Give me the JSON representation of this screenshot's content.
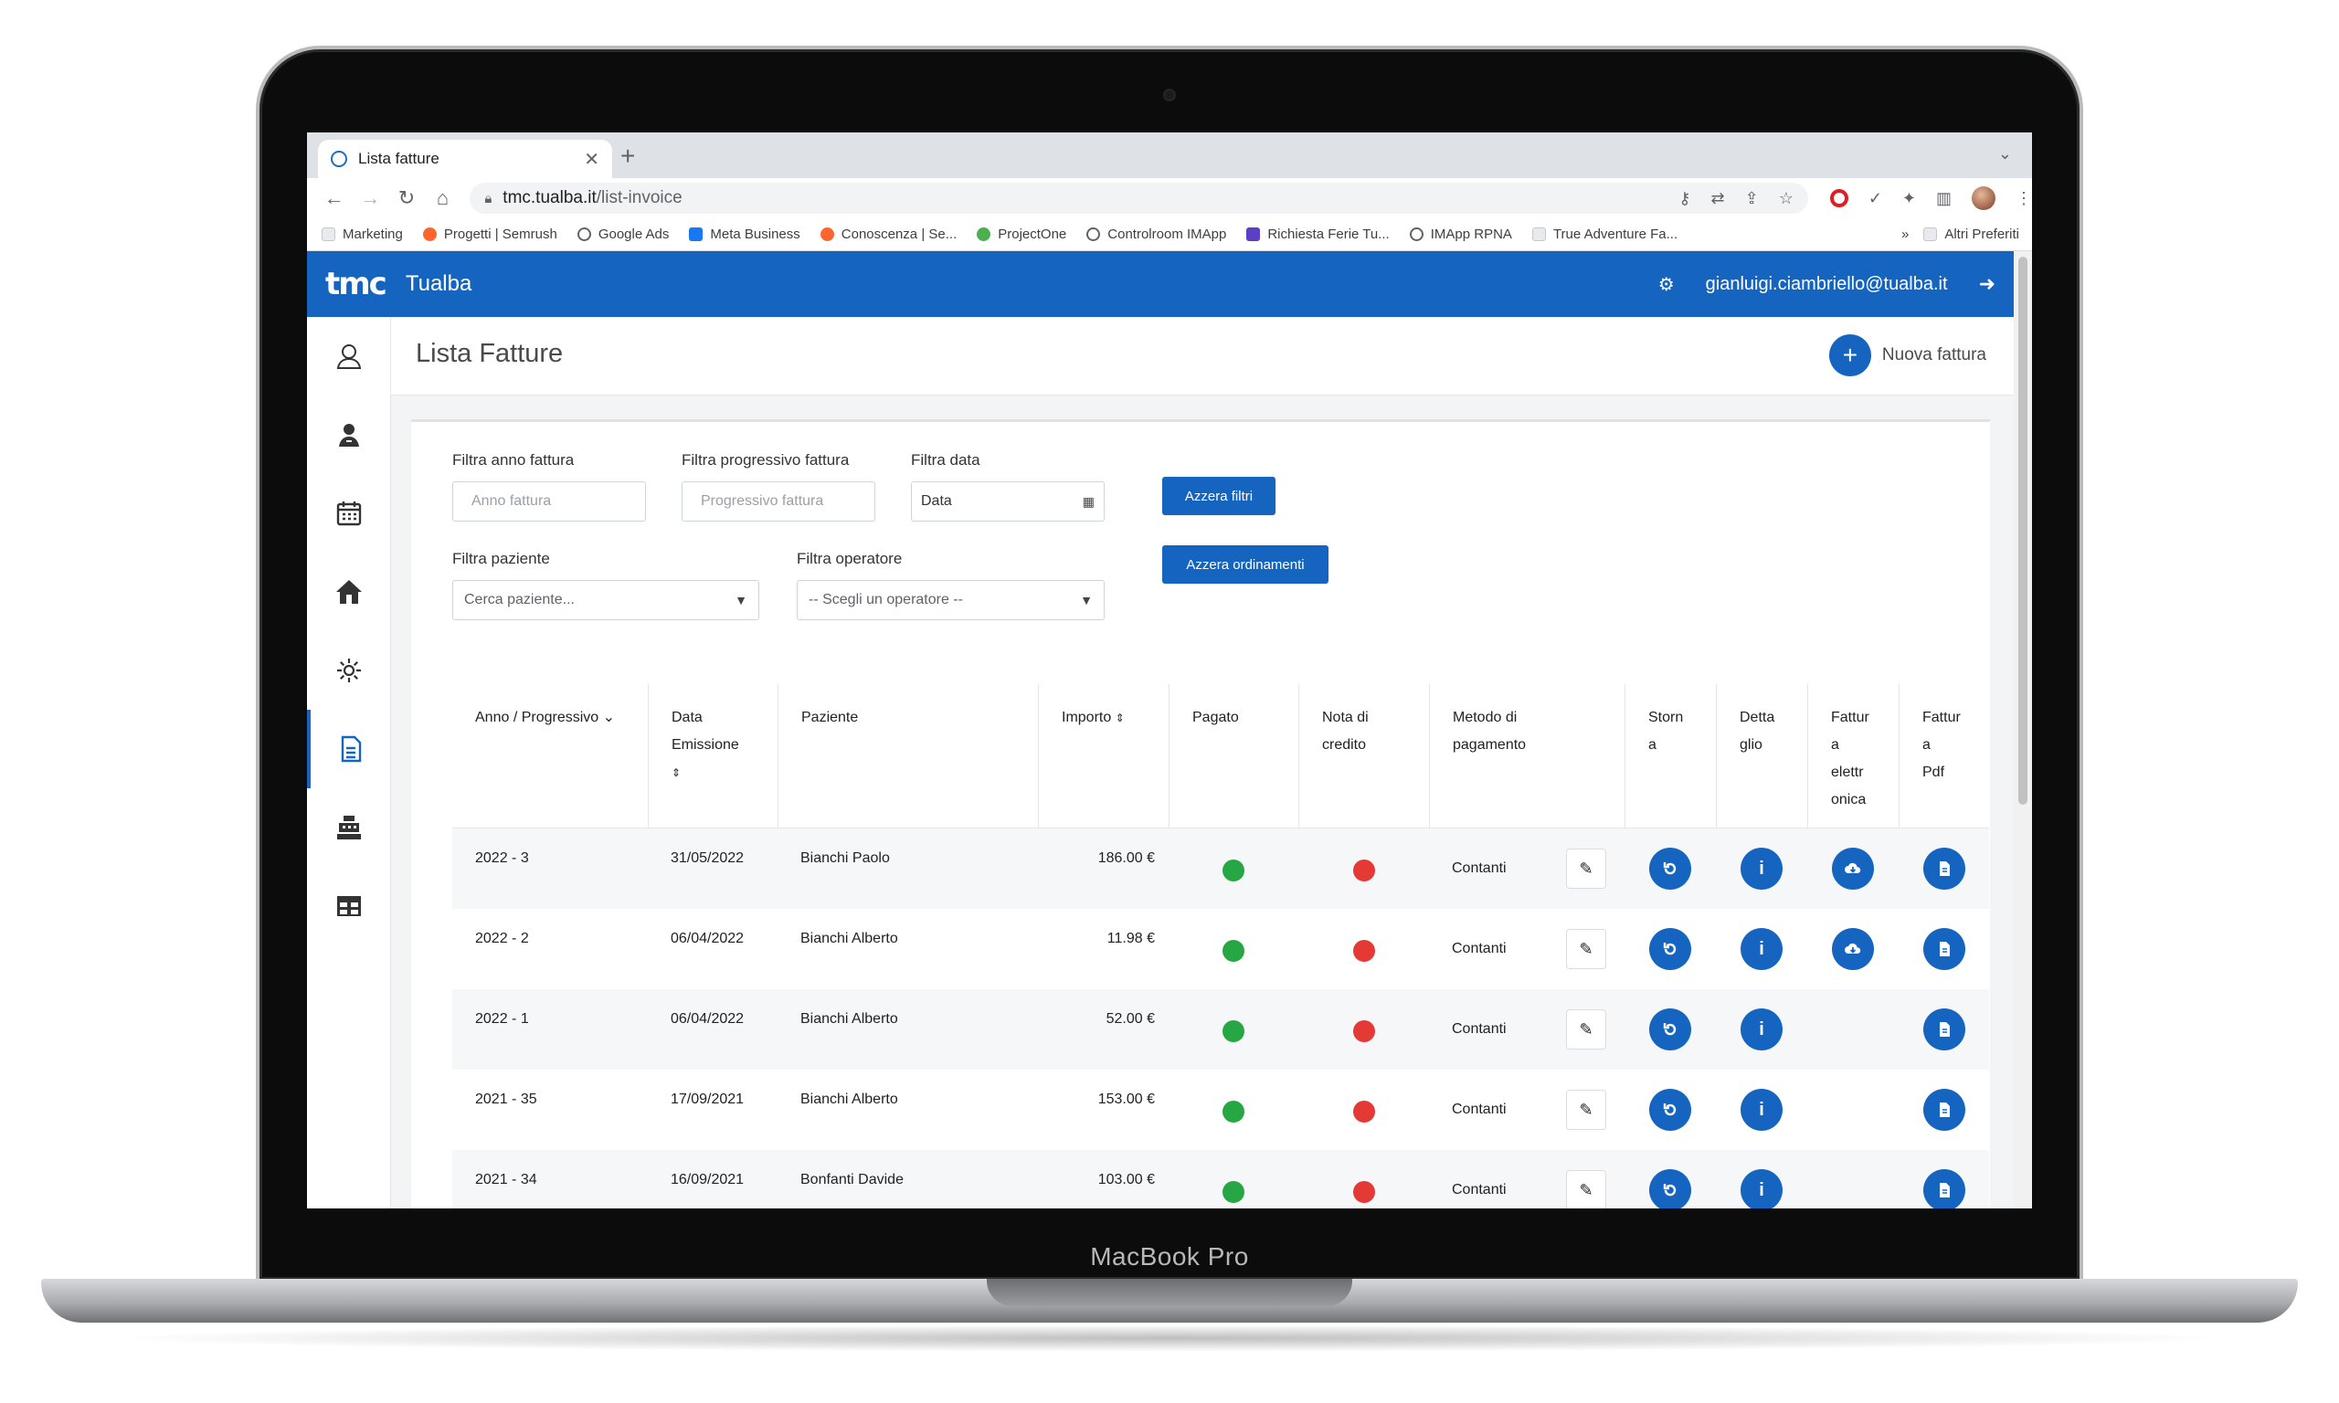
{
  "browser": {
    "tab_title": "Lista fatture",
    "url_host": "tmc.tualba.it",
    "url_path": "/list-invoice",
    "bookmarks": [
      "Marketing",
      "Progetti | Semrush",
      "Google Ads",
      "Meta Business",
      "Conoscenza | Se...",
      "ProjectOne",
      "Controlroom IMApp",
      "Richiesta Ferie Tu...",
      "IMApp RPNA",
      "True Adventure Fa..."
    ],
    "bookmarks_more": "»",
    "other_bookmarks": "Altri Preferiti"
  },
  "app": {
    "logo": "tmc",
    "name": "Tualba",
    "user_email": "gianluigi.ciambriello@tualba.it",
    "brand_color": "#1565c0"
  },
  "page": {
    "title": "Lista Fatture",
    "new_invoice_label": "Nuova fattura"
  },
  "filters": {
    "year_label": "Filtra anno fattura",
    "year_placeholder": "Anno fattura",
    "progressive_label": "Filtra progressivo fattura",
    "progressive_placeholder": "Progressivo fattura",
    "date_label": "Filtra data",
    "date_value": "Data",
    "patient_label": "Filtra paziente",
    "patient_value": "Cerca paziente...",
    "operator_label": "Filtra operatore",
    "operator_value": "-- Scegli un operatore --",
    "reset_filters": "Azzera filtri",
    "reset_sort": "Azzera ordinamenti"
  },
  "table": {
    "headers": {
      "year_prog": "Anno / Progressivo",
      "date": "Data Emissione",
      "patient": "Paziente",
      "amount": "Importo",
      "paid": "Pagato",
      "credit_note": "Nota di credito",
      "payment_method": "Metodo di pagamento",
      "reverse": "Storn a",
      "detail": "Detta glio",
      "e_invoice": "Fattur a elettr onica",
      "pdf": "Fattur a Pdf"
    },
    "rows": [
      {
        "year_prog": "2022 - 3",
        "date": "31/05/2022",
        "patient": "Bianchi Paolo",
        "amount": "186.00 €",
        "paid": true,
        "credit_note": false,
        "method": "Contanti",
        "e_invoice": true
      },
      {
        "year_prog": "2022 - 2",
        "date": "06/04/2022",
        "patient": "Bianchi Alberto",
        "amount": "11.98 €",
        "paid": true,
        "credit_note": false,
        "method": "Contanti",
        "e_invoice": true
      },
      {
        "year_prog": "2022 - 1",
        "date": "06/04/2022",
        "patient": "Bianchi Alberto",
        "amount": "52.00 €",
        "paid": true,
        "credit_note": false,
        "method": "Contanti",
        "e_invoice": false
      },
      {
        "year_prog": "2021 - 35",
        "date": "17/09/2021",
        "patient": "Bianchi Alberto",
        "amount": "153.00 €",
        "paid": true,
        "credit_note": false,
        "method": "Contanti",
        "e_invoice": false
      },
      {
        "year_prog": "2021 - 34",
        "date": "16/09/2021",
        "patient": "Bonfanti Davide",
        "amount": "103.00 €",
        "paid": true,
        "credit_note": false,
        "method": "Contanti",
        "e_invoice": false
      }
    ]
  },
  "device": {
    "label": "MacBook Pro"
  }
}
